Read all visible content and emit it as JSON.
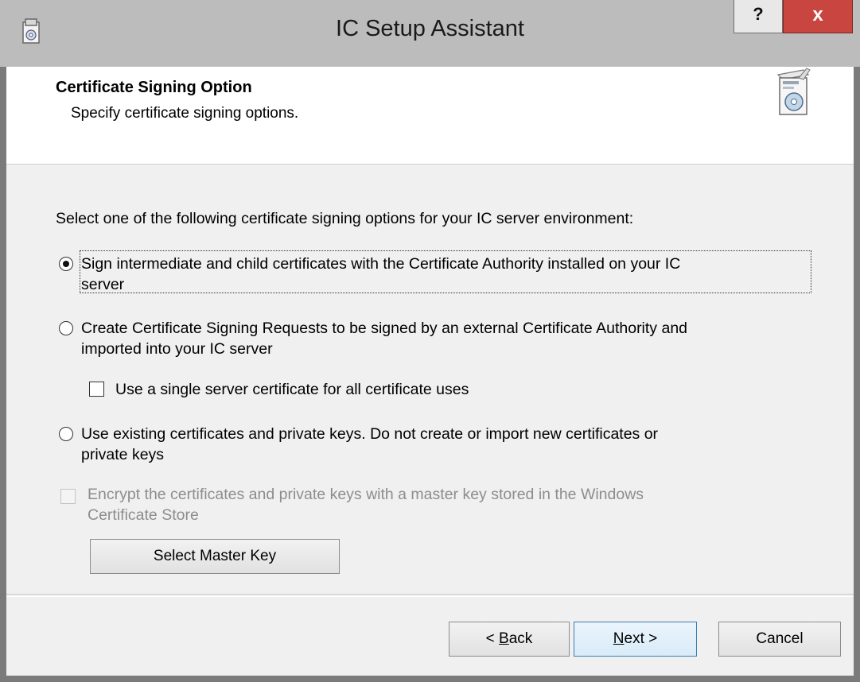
{
  "window": {
    "title": "IC Setup Assistant",
    "help_label": "?",
    "close_label": "x",
    "icon": "setup-assistant-icon"
  },
  "header": {
    "title": "Certificate Signing Option",
    "subtitle": "Specify certificate signing options.",
    "icon": "software-box-icon"
  },
  "main": {
    "instruction": "Select one of the following certificate signing options for your IC server environment:",
    "options": [
      {
        "label": "Sign intermediate and child certificates with the Certificate Authority installed on your IC server",
        "line1": "Sign intermediate and child certificates with the Certificate Authority installed on your IC",
        "line2": "server",
        "selected": true
      },
      {
        "label": "Create Certificate Signing Requests to be signed by an external Certificate Authority and imported into your IC server",
        "line1": "Create Certificate Signing Requests to be signed by an external Certificate Authority and",
        "line2": "imported into your IC server",
        "selected": false
      },
      {
        "label": "Use existing certificates and private keys. Do not create or import new certificates or private keys",
        "line1": "Use existing certificates and private keys. Do not create or import new certificates or",
        "line2": "private keys",
        "selected": false
      }
    ],
    "single_cert_checkbox": {
      "label": "Use a single server certificate for all certificate uses",
      "checked": false
    },
    "encrypt_checkbox": {
      "label": "Encrypt the certificates and private keys with a master key stored in the Windows Certificate Store",
      "line1": "Encrypt the certificates and private keys with a master key stored in the Windows",
      "line2": "Certificate Store",
      "checked": false,
      "enabled": false
    },
    "select_master_key_label": "Select Master Key"
  },
  "footer": {
    "back_label": "< Back",
    "back_mnemonic": "B",
    "next_label": "Next >",
    "next_mnemonic": "N",
    "cancel_label": "Cancel"
  }
}
